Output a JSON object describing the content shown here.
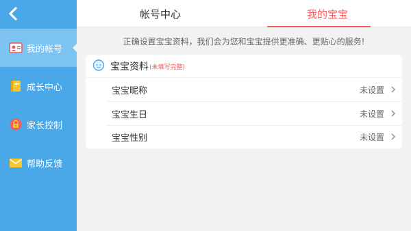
{
  "sidebar": {
    "items": [
      {
        "label": "我的帐号",
        "icon": "id-card-icon",
        "active": true
      },
      {
        "label": "成长中心",
        "icon": "notebook-icon",
        "active": false
      },
      {
        "label": "家长控制",
        "icon": "lock-icon",
        "active": false
      },
      {
        "label": "帮助反馈",
        "icon": "envelope-icon",
        "active": false
      }
    ]
  },
  "tabs": [
    {
      "label": "帐号中心",
      "active": false
    },
    {
      "label": "我的宝宝",
      "active": true
    }
  ],
  "notice": "正确设置宝宝资料，我们会为您和宝宝提供更准确、更贴心的服务!",
  "baby_profile": {
    "title": "宝宝资料",
    "subtitle": "(未填写完整)",
    "rows": [
      {
        "label": "宝宝昵称",
        "value": "未设置"
      },
      {
        "label": "宝宝生日",
        "value": "未设置"
      },
      {
        "label": "宝宝性别",
        "value": "未设置"
      }
    ]
  },
  "colors": {
    "sidebar": "#4aa8e8",
    "sidebar_active": "#7cc3f1",
    "accent": "#f25d5d",
    "background": "#f2f2f4"
  }
}
